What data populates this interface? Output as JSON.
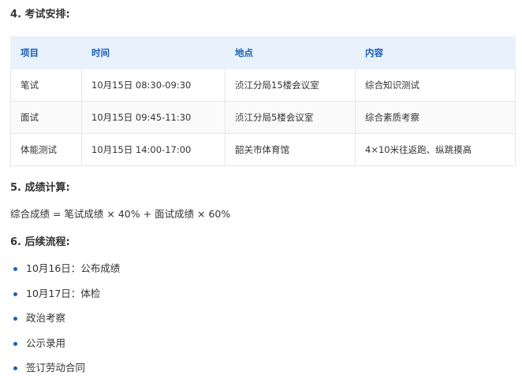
{
  "sections": {
    "exam_heading": "4. 考试安排:",
    "score_heading": "5. 成绩计算:",
    "follow_heading": "6. 后续流程:"
  },
  "table": {
    "headers": [
      "项目",
      "时间",
      "地点",
      "内容"
    ],
    "rows": [
      [
        "笔试",
        "10月15日 08:30-09:30",
        "浈江分局15楼会议室",
        "综合知识测试"
      ],
      [
        "面试",
        "10月15日 09:45-11:30",
        "浈江分局5楼会议室",
        "综合素质考察"
      ],
      [
        "体能测试",
        "10月15日 14:00-17:00",
        "韶关市体育馆",
        "4×10米往返跑、纵跳摸高"
      ]
    ]
  },
  "formula": "综合成绩 = 笔试成绩 × 40% + 面试成绩 × 60%",
  "steps": [
    "10月16日：公布成绩",
    "10月17日：体检",
    "政治考察",
    "公示录用",
    "签订劳动合同"
  ],
  "colors": {
    "accent": "#1a5fb4",
    "header_bg": "#e8f1fc"
  }
}
